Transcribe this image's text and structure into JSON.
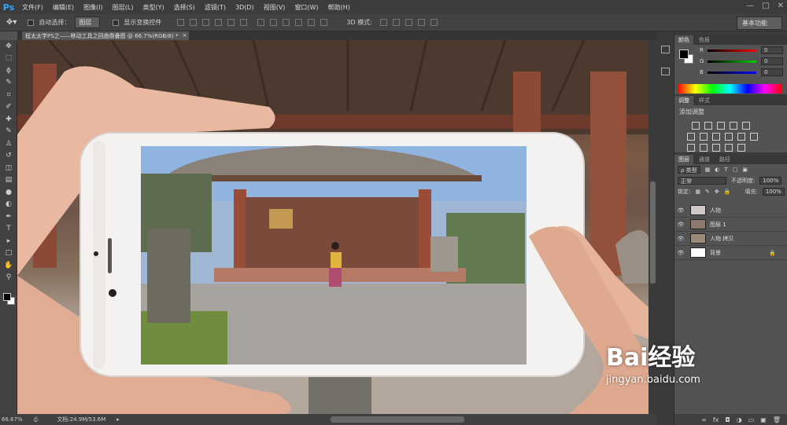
{
  "app": {
    "logo": "Ps"
  },
  "menu": [
    "文件(F)",
    "编辑(E)",
    "图像(I)",
    "图层(L)",
    "类型(Y)",
    "选择(S)",
    "滤镜(T)",
    "3D(D)",
    "视图(V)",
    "窗口(W)",
    "帮助(H)"
  ],
  "window_buttons": [
    "—",
    "□",
    "✕"
  ],
  "options": {
    "auto_select_label": "自动选择：",
    "auto_select_value": "图层",
    "show_transform_label": "显示变换控件",
    "mode_3d_label": "3D 模式:",
    "workspace": "基本功能"
  },
  "document": {
    "tab_title": "程太太学PS之——移动工具之回曲倒叠图 @ 66.7%(RGB/8) *",
    "tab_close": "×",
    "zoom": "66.67%",
    "doc_size": "文档:24.9M/53.6M"
  },
  "tools": [
    "move-icon",
    "marquee-icon",
    "lasso-icon",
    "quick-select-icon",
    "crop-icon",
    "eyedropper-icon",
    "healing-icon",
    "brush-icon",
    "stamp-icon",
    "history-brush-icon",
    "eraser-icon",
    "gradient-icon",
    "blur-icon",
    "dodge-icon",
    "pen-icon",
    "type-icon",
    "path-select-icon",
    "shape-icon",
    "hand-icon",
    "zoom-icon"
  ],
  "tool_glyphs": [
    "✥",
    "⬚",
    "ϕ",
    "✎",
    "⌗",
    "✐",
    "✚",
    "✎",
    "♙",
    "↺",
    "◫",
    "▤",
    "●",
    "◐",
    "✒",
    "T",
    "▸",
    "□",
    "✋",
    "⚲"
  ],
  "color_panel": {
    "tabs": [
      "颜色",
      "色板"
    ],
    "channels": [
      {
        "label": "R",
        "value": "0",
        "color": "#d33"
      },
      {
        "label": "G",
        "value": "0",
        "color": "#3a3"
      },
      {
        "label": "B",
        "value": "0",
        "color": "#33d"
      }
    ]
  },
  "adjust_panel": {
    "tabs": [
      "调整",
      "样式"
    ],
    "title": "添加调整"
  },
  "layers_panel": {
    "tabs": [
      "图层",
      "通道",
      "路径"
    ],
    "filter": "ρ 类型",
    "blend_mode": "正常",
    "opacity_label": "不透明度:",
    "opacity_value": "100%",
    "lock_label": "锁定:",
    "fill_label": "填充:",
    "fill_value": "100%",
    "layers": [
      {
        "name": "人物",
        "thumb": "#cfc8c4",
        "selected": false
      },
      {
        "name": "图层 1",
        "thumb": "#8d7a6e",
        "selected": false
      },
      {
        "name": "人物 拷贝",
        "thumb": "#9a8a7a",
        "selected": false
      },
      {
        "name": "背景",
        "thumb": "#ffffff",
        "selected": false,
        "locked": true
      }
    ],
    "footer_icons": [
      "∞",
      "fx",
      "◘",
      "◑",
      "▭",
      "▣",
      "🗑"
    ]
  },
  "watermark": {
    "logo": "Bai经验",
    "url": "jingyan.baidu.com"
  }
}
